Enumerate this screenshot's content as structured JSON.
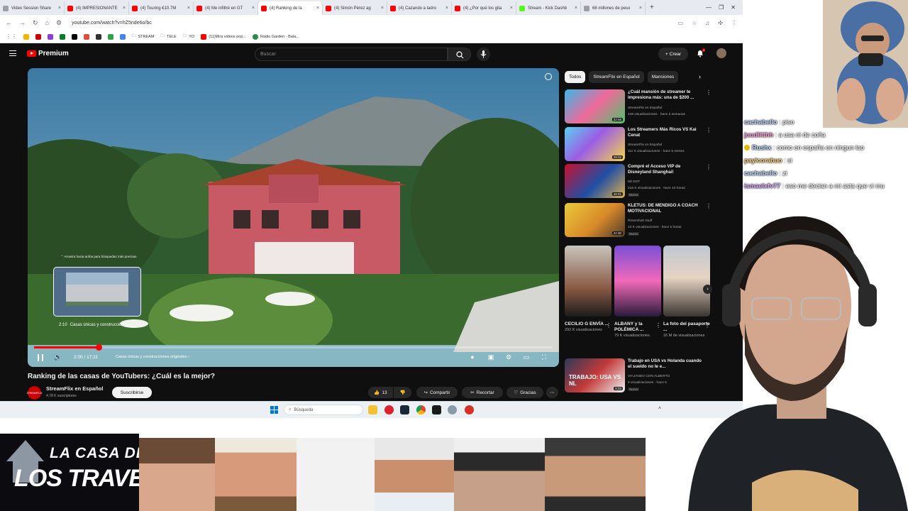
{
  "browser": {
    "tabs": [
      {
        "label": "Video Session Share",
        "fav": "gray"
      },
      {
        "label": "(4) IMPRESIONANTE",
        "fav": "red"
      },
      {
        "label": "(4) Touring €10.7M",
        "fav": "red"
      },
      {
        "label": "(4) Me infiltré en GT",
        "fav": "red"
      },
      {
        "label": "(4) Ranking de la",
        "fav": "red",
        "active": true
      },
      {
        "label": "(4) Simón Pérez ag",
        "fav": "red"
      },
      {
        "label": "(4) Cazando a ladro",
        "fav": "red"
      },
      {
        "label": "(4) ¿Por qué los gita",
        "fav": "red"
      },
      {
        "label": "Stream - Kick Dashb",
        "fav": "green"
      },
      {
        "label": "68 millones de peso",
        "fav": "gray"
      }
    ],
    "url": "youtube.com/watch?v=hZ5nde6o/bc",
    "bookmarks": [
      "STREAM",
      "TELE",
      "YO",
      "(11)Mira videos pop...",
      "Radio Garden - Bala..."
    ]
  },
  "youtube": {
    "logo_text": "Premium",
    "search_placeholder": "Buscar",
    "create_label": "Crear",
    "notif_count": "4"
  },
  "player": {
    "hint": "⌃ Arrastra hacia arriba para búsquedas más precisas",
    "preview_time": "2:10",
    "preview_chapter": "Casas únicas y construccion...",
    "time_display": "2:00 / 17:21",
    "chapter": "Casas únicas y construcciones originales  ›",
    "progress_fraction": 0.125
  },
  "video": {
    "title": "Ranking de las casas de YouTubers: ¿Cuál es la mejor?",
    "channel": "StreamFlix en Español",
    "channel_avatar_text": "STREAMFLIX",
    "subs": "4,78 K suscriptores",
    "subscribe": "Suscribirse",
    "likes": "13",
    "share": "Compartir",
    "clip": "Recortar",
    "thanks": "Gracias"
  },
  "sidebar": {
    "chips": [
      "Todos",
      "StreamFlix en Español",
      "Mansiones"
    ],
    "recommendations": [
      {
        "title": "¿Cuál mansión de streamer te impresiona más: una de $200 ...",
        "channel": "StreamFlix en Español",
        "meta": "448 visualizaciones · hace 2 semanas",
        "duration": "22:46",
        "tag": ""
      },
      {
        "title": "Los Streamers Más Ricos VS Kai Cenat",
        "channel": "StreamFlix en Español",
        "meta": "111 K visualizaciones · hace 5 meses",
        "duration": "29:32",
        "tag": ""
      },
      {
        "title": "Compré el Acceso VIP de Disneyland Shanghai!",
        "channel": "Nil OGT",
        "meta": "216 K visualizaciones · hace 10 horas",
        "duration": "48:01",
        "tag": "Nuevo"
      },
      {
        "title": "KLETUS: DE MENDIGO A COACH MOTIVACIONAL",
        "channel": "Rimembah Stuff",
        "meta": "13 K visualizaciones · hace 5 horas",
        "duration": "22:30",
        "tag": "Nuevo"
      }
    ],
    "shorts": [
      {
        "title": "CECILIO G ENVÍA ...",
        "views": "292 K visualizaciones"
      },
      {
        "title": "ALBANY y la POLÉMICA ...",
        "views": "79 K visualizaciones"
      },
      {
        "title": "La foto del pasaporte ...",
        "views": "16 M de visualizaciones"
      }
    ],
    "last_rec": {
      "title": "Trabajo en USA vs Holanda cuando el sueldo no le e...",
      "channel": "VIAJANDO CON ALBERTO",
      "meta": "9 visualizaciones · hace 5",
      "duration": "8:03",
      "tag": "Nuevo",
      "thumb_text": "TRABAJO: USA VS NL"
    }
  },
  "taskbar": {
    "search_label": "Búsqueda"
  },
  "chat": [
    {
      "user": "cachabello",
      "msg": "piso",
      "color": "#b9d7ff",
      "badge": false
    },
    {
      "user": "juudiitthh",
      "msg": "a usa ni de coña",
      "color": "#ff9ed8",
      "badge": false
    },
    {
      "user": "Rushx",
      "msg": "como en españa en ningun lao",
      "color": "#b9d7ff",
      "badge": true
    },
    {
      "user": "payicorabuo",
      "msg": "si",
      "color": "#ffd27a",
      "badge": false
    },
    {
      "user": "cachabello",
      "msg": "zi",
      "color": "#b9d7ff",
      "badge": false
    },
    {
      "user": "ismaelxfv77",
      "msg": "eso me decian a mi asta que vi mu",
      "color": "#d6a8ff",
      "badge": false
    }
  ],
  "banner": {
    "line1": "LA CASA DE",
    "line2": "LOS TRAVELOS"
  }
}
